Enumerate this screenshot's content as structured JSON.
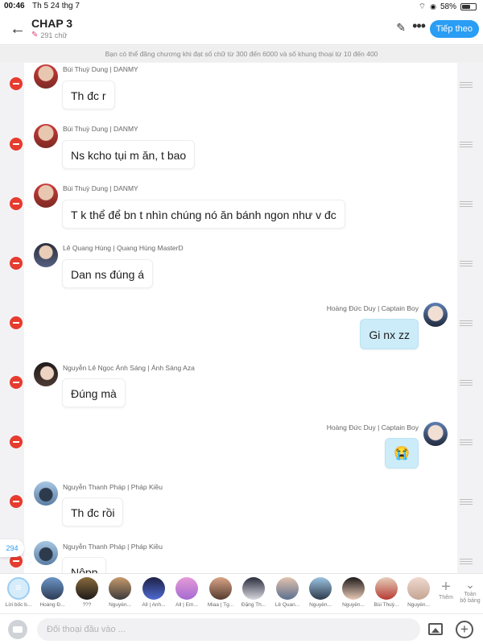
{
  "status_bar": {
    "time": "00:46",
    "date": "Th 5 24 thg 7",
    "battery": "58%",
    "battery_level": 0.58
  },
  "header": {
    "title": "CHAP 3",
    "word_count": "291 chữ",
    "next_label": "Tiếp theo",
    "accent_color": "#2a9df4"
  },
  "notice": "Bạn có thể đăng chương khi đạt số chữ từ 300 đến 6000 và số khung thoại từ 10 đến 400",
  "messages": [
    {
      "speaker": "Bùi Thuỳ Dung | DANMY",
      "text": "Th đc r",
      "side": "left"
    },
    {
      "speaker": "Bùi Thuỳ Dung | DANMY",
      "text": "Ns kcho tụi m ăn, t bao",
      "side": "left"
    },
    {
      "speaker": "Bùi Thuỳ Dung | DANMY",
      "text": "T k thể để bn t nhìn chúng nó ăn bánh ngon như v đc",
      "side": "left"
    },
    {
      "speaker": "Lê Quang Hùng | Quang Hùng MasterD",
      "text": "Dan ns đúng á",
      "side": "left"
    },
    {
      "speaker": "Hoàng Đức Duy | Captain Boy",
      "text": "Gi nx zz",
      "side": "right"
    },
    {
      "speaker": "Nguyễn Lê Ngọc Ánh Sáng | Ánh Sáng Aza",
      "text": "Đúng mà",
      "side": "left"
    },
    {
      "speaker": "Hoàng Đức Duy | Captain Boy",
      "text": "😭",
      "side": "right"
    },
    {
      "speaker": "Nguyễn Thanh Pháp | Pháp Kiều",
      "text": "Th đc rồi",
      "side": "left"
    },
    {
      "speaker": "Nguyễn Thanh Pháp | Pháp Kiều",
      "text": "Nộpp",
      "side": "left"
    }
  ],
  "counter": "294",
  "characters": [
    "Lời bốc b...",
    "Hoàng Đ...",
    "???",
    "Nguyễn...",
    "All | Anh...",
    "All | Em...",
    "Miaa | Tg...",
    "Đặng Th...",
    "Lê Quan...",
    "Nguyễn...",
    "Nguyễn...",
    "Bùi Thuỳ...",
    "Nguyễn..."
  ],
  "add_character_label": "Thêm",
  "all_characters_label_1": "Toàn",
  "all_characters_label_2": "bộ bảng",
  "input": {
    "placeholder": "Đối thoại đầu vào ..."
  },
  "colors": {
    "delete": "#e63b2e",
    "my_bubble": "#ccecf9"
  }
}
